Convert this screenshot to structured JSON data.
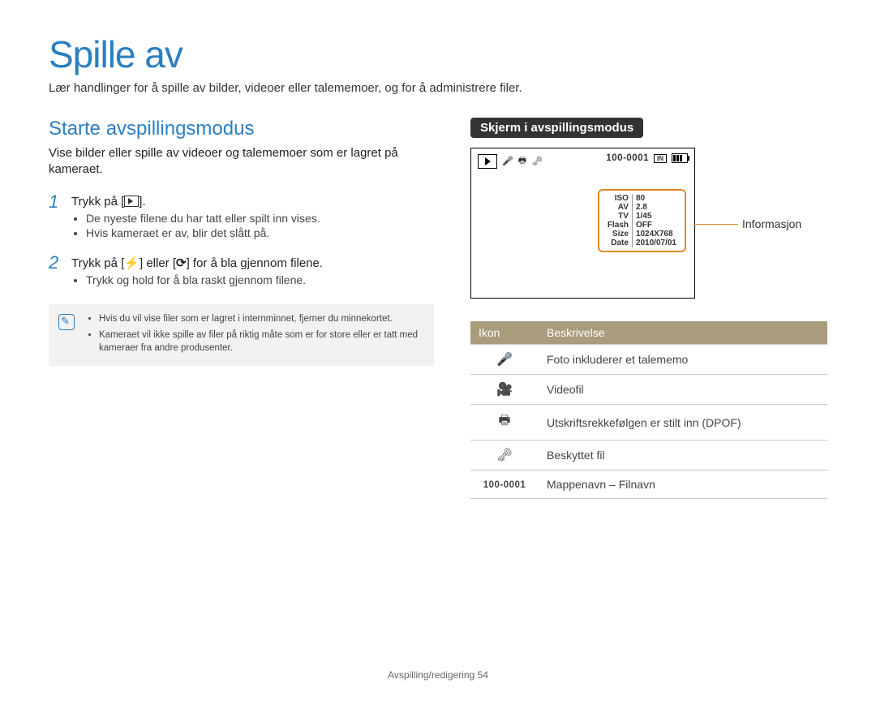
{
  "page": {
    "title": "Spille av",
    "intro": "Lær handlinger for å spille av bilder, videoer eller talememoer, og for å administrere filer.",
    "footer_section": "Avspilling/redigering",
    "footer_page": "54"
  },
  "left": {
    "title": "Starte avspillingsmodus",
    "intro": "Vise bilder eller spille av videoer og talememoer som er lagret på kameraet.",
    "steps": [
      {
        "num": "1",
        "main_pre": "Trykk på [",
        "main_post": "].",
        "sub": [
          "De nyeste filene du har tatt eller spilt inn vises.",
          "Hvis kameraet er av, blir det slått på."
        ]
      },
      {
        "num": "2",
        "main_pre": "Trykk på [",
        "main_mid": "] eller [",
        "main_post": "] for å bla gjennom filene.",
        "sub": [
          "Trykk og hold for å bla raskt gjennom filene."
        ]
      }
    ],
    "note": [
      "Hvis du vil vise filer som er lagret i internminnet, fjerner du minnekortet.",
      "Kameraet vil ikke spille av filer på riktig måte som er for store eller er tatt med kameraer fra andre produsenter."
    ]
  },
  "right": {
    "pill": "Skjerm i avspillingsmodus",
    "folder_file": "100-0001",
    "info_label": "Informasjon",
    "info_rows": [
      {
        "k": "ISO",
        "v": "80"
      },
      {
        "k": "AV",
        "v": "2.8"
      },
      {
        "k": "TV",
        "v": "1/45"
      },
      {
        "k": "Flash",
        "v": "OFF"
      },
      {
        "k": "Size",
        "v": "1024X768"
      },
      {
        "k": "Date",
        "v": "2010/07/01"
      }
    ],
    "table": {
      "head_icon": "Ikon",
      "head_desc": "Beskrivelse",
      "rows": [
        {
          "icon": "mic-icon",
          "desc": "Foto inkluderer et talememo"
        },
        {
          "icon": "video-icon",
          "desc": "Videofil"
        },
        {
          "icon": "print-icon",
          "desc": "Utskriftsrekkefølgen er stilt inn (DPOF)"
        },
        {
          "icon": "lock-icon",
          "desc": "Beskyttet fil"
        },
        {
          "icon": "folder-file-icon",
          "desc": "Mappenavn – Filnavn"
        }
      ],
      "folder_file_label": "100-0001"
    }
  }
}
